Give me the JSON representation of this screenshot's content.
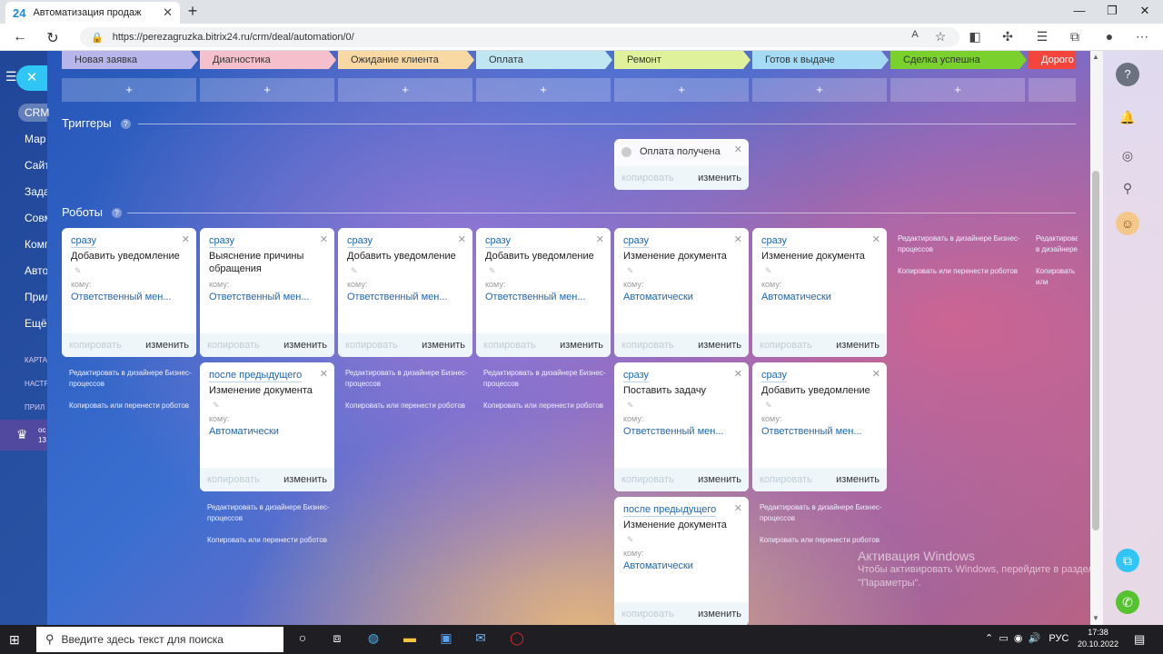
{
  "browser": {
    "tab_icon": "24",
    "tab_title": "Автоматизация продаж",
    "url": "https://perezagruzka.bitrix24.ru/crm/deal/automation/0/",
    "font_size_control": "A"
  },
  "left_menu": {
    "crm": "CRM",
    "items": [
      "Мар",
      "Сайт",
      "Зада",
      "Совм",
      "Комп",
      "Авто",
      "Прил",
      "Ещё"
    ],
    "small_items": [
      "КАРТА",
      "НАСТР",
      "ПРИЛ"
    ],
    "user_line1": "ос",
    "user_line2": "13"
  },
  "stages": [
    {
      "label": "Новая заявка",
      "color": "#b8b5ea"
    },
    {
      "label": "Диагностика",
      "color": "#f5c0cc"
    },
    {
      "label": "Ожидание клиента",
      "color": "#f8d9a3"
    },
    {
      "label": "Оплата",
      "color": "#bfe6f2"
    },
    {
      "label": "Ремонт",
      "color": "#dff29b"
    },
    {
      "label": "Готов к выдаче",
      "color": "#a6dbf5"
    },
    {
      "label": "Сделка успешна",
      "color": "#7ad02c"
    },
    {
      "label": "Дорого",
      "color": "#f3453c"
    }
  ],
  "add_symbol": "+",
  "triggers": {
    "title": "Триггеры",
    "help": "?",
    "card": {
      "name": "Оплата получена",
      "copy": "копировать",
      "edit": "изменить"
    }
  },
  "robots": {
    "title": "Роботы",
    "help": "?",
    "copy": "копировать",
    "edit": "изменить",
    "to_label": "кому:",
    "edit_link": "Редактировать в дизайнере Бизнес-процессов",
    "move_link": "Копировать или перенести роботов",
    "edit_link_short": "Редактировать в дизайнере Бизнес-процесс",
    "move_link_short": "Копировать или перенести роботов",
    "cards": [
      {
        "cond": "сразу",
        "name": "Добавить уведомление",
        "value": "Ответственный мен..."
      },
      {
        "cond": "сразу",
        "name": "Выяснение причины обращения",
        "value": "Ответственный мен..."
      },
      {
        "cond": "сразу",
        "name": "Добавить уведомление",
        "value": "Ответственный мен..."
      },
      {
        "cond": "сразу",
        "name": "Добавить уведомление",
        "value": "Ответственный мен..."
      },
      {
        "cond": "сразу",
        "name": "Изменение документа",
        "value": "Автоматически"
      },
      {
        "cond": "сразу",
        "name": "Изменение документа",
        "value": "Автоматически"
      },
      {
        "cond": "после предыдущего",
        "name": "Изменение документа",
        "value": "Автоматически"
      },
      {
        "cond": "сразу",
        "name": "Поставить задачу",
        "value": "Ответственный мен..."
      },
      {
        "cond": "сразу",
        "name": "Добавить уведомление",
        "value": "Ответственный мен..."
      },
      {
        "cond": "после предыдущего",
        "name": "Изменение документа",
        "value": "Автоматически"
      }
    ]
  },
  "watermark": {
    "line1": "Активация Windows",
    "line2": "Чтобы активировать Windows, перейдите в раздел",
    "line3": "\"Параметры\"."
  },
  "taskbar": {
    "search_placeholder": "Введите здесь текст для поиска",
    "lang": "РУС",
    "time": "17:38",
    "date": "20.10.2022"
  }
}
